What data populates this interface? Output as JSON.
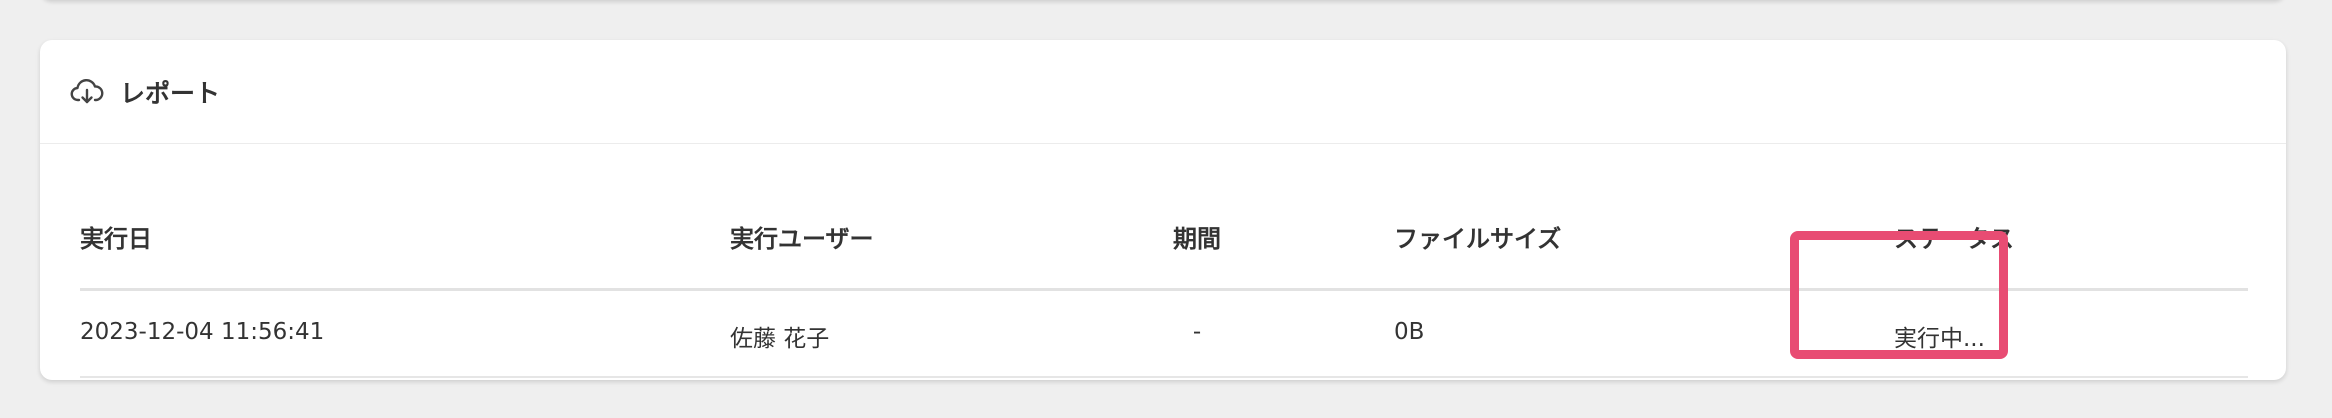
{
  "report": {
    "title": "レポート",
    "icon": "cloud-download-icon",
    "columns": [
      "実行日",
      "実行ユーザー",
      "期間",
      "ファイルサイズ",
      "ステータス"
    ],
    "rows": [
      {
        "executed_at": "2023-12-04 11:56:41",
        "user": "佐藤 花子",
        "period": "-",
        "file_size": "0B",
        "status": "実行中..."
      }
    ]
  },
  "colors": {
    "highlight": "#e84c73",
    "background": "#efefef",
    "card": "#ffffff"
  }
}
